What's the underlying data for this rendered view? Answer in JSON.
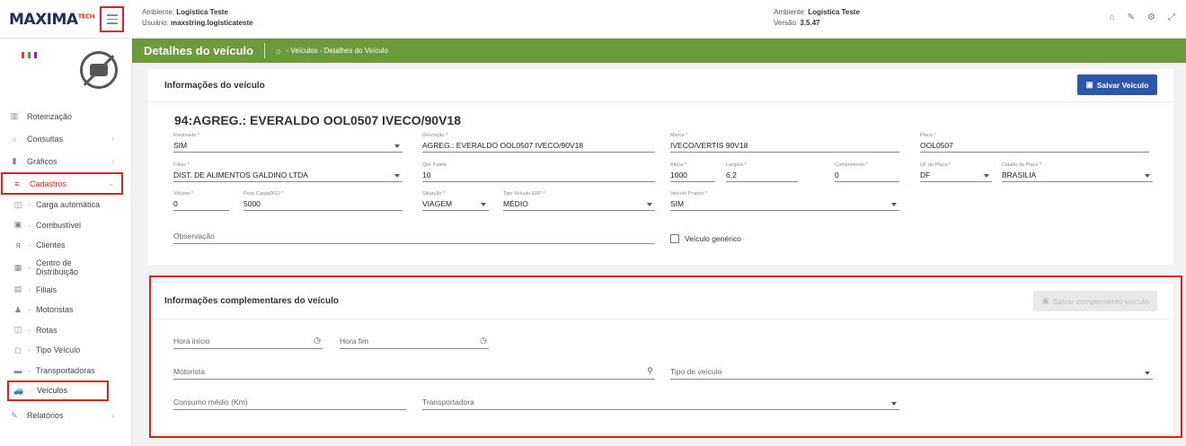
{
  "topbar": {
    "logo_main": "MAXIMA",
    "logo_sup": "TECH",
    "env_left_label": "Ambiente:",
    "env_left_value": "Logística Teste",
    "user_label": "Usuário:",
    "user_value": "maxstring.logisticateste",
    "env_center_label": "Ambiente:",
    "env_center_value": "Logística Teste",
    "version_label": "Versão:",
    "version_value": "3.5.47",
    "icons": [
      "home-icon",
      "edit-icon",
      "settings-icon",
      "fullscreen-icon"
    ]
  },
  "sidebar": {
    "items": [
      {
        "label": "Roteirização",
        "icon": "map-icon"
      },
      {
        "label": "Consultas",
        "icon": "search-icon",
        "chevron": "›"
      },
      {
        "label": "Gráficos",
        "icon": "chart-icon",
        "chevron": "›"
      },
      {
        "label": "Cadastros",
        "icon": "list-icon",
        "chevron": "⌄"
      },
      {
        "label": "Carga automática",
        "icon": "truck-icon"
      },
      {
        "label": "Combustível",
        "icon": "fuel-icon"
      },
      {
        "label": "Clientes",
        "icon": "users-icon"
      },
      {
        "label": "Centro de Distribuição",
        "icon": "building-icon"
      },
      {
        "label": "Filiais",
        "icon": "branch-icon"
      },
      {
        "label": "Motoristas",
        "icon": "driver-icon"
      },
      {
        "label": "Rotas",
        "icon": "route-icon"
      },
      {
        "label": "Tipo Veículo",
        "icon": "vehicle-type-icon"
      },
      {
        "label": "Transportadoras",
        "icon": "carrier-icon"
      },
      {
        "label": "Veículos",
        "icon": "car-icon"
      },
      {
        "label": "Relatórios",
        "icon": "report-icon",
        "chevron": "›"
      }
    ]
  },
  "header": {
    "title": "Detalhes do veículo",
    "breadcrumb": "- Veículos - Detalhes do Veículo"
  },
  "vehicle_info": {
    "section_title": "Informações do veículo",
    "save_label": "Salvar Veículo",
    "vehicle_title": "94:AGREG.: EVERALDO OOL0507 IVECO/90V18",
    "fields": {
      "rastreado": {
        "label": "Rastreado *",
        "value": "SIM"
      },
      "descricao": {
        "label": "Descrição *",
        "value": "AGREG.: EVERALDO OOL0507 IVECO/90V18"
      },
      "marca": {
        "label": "Marca *",
        "value": "IVECO/VERTIS 90V18"
      },
      "placa": {
        "label": "Placa *",
        "value": "OOL0507"
      },
      "filiais": {
        "label": "Filiais *",
        "value": "DIST. DE ALIMENTOS GALDINO LTDA"
      },
      "qtd_palete": {
        "label": "Qtd. Palete",
        "value": "10"
      },
      "altura": {
        "label": "Altura *",
        "value": "1000"
      },
      "largura": {
        "label": "Largura *",
        "value": "6,2"
      },
      "comprimento": {
        "label": "Comprimento *",
        "value": "0"
      },
      "uf_placa": {
        "label": "UF da Placa *",
        "value": "DF"
      },
      "cidade_placa": {
        "label": "Cidade da Placa *",
        "value": "BRASILIA"
      },
      "volume": {
        "label": "Volume *",
        "value": "0"
      },
      "peso_carga": {
        "label": "Peso Carga(KG) *",
        "value": "5000"
      },
      "situacao": {
        "label": "Situação *",
        "value": "VIAGEM"
      },
      "tipo_veiculo_erp": {
        "label": "Tipo Veículo ERP *",
        "value": "MÉDIO"
      },
      "veiculo_proprio": {
        "label": "Veículo Proprio *",
        "value": "SIM"
      },
      "observacao": {
        "placeholder": "Observação"
      },
      "veiculo_generico": {
        "label": "Veículo genérico"
      }
    }
  },
  "complement": {
    "section_title": "Informações complementares do veículo",
    "save_label": "Salvar complemento veículo",
    "hora_inicio": "Hora início",
    "hora_fim": "Hora fim",
    "motorista": "Motorista",
    "tipo_veiculo": "Tipo de veículo",
    "consumo_medio": "Consumo médio (Km)",
    "transportadora": "Transportadora"
  },
  "colors": {
    "header_green": "#6b9a3a",
    "primary_blue": "#2c57a8",
    "highlight_red": "#e02020"
  }
}
